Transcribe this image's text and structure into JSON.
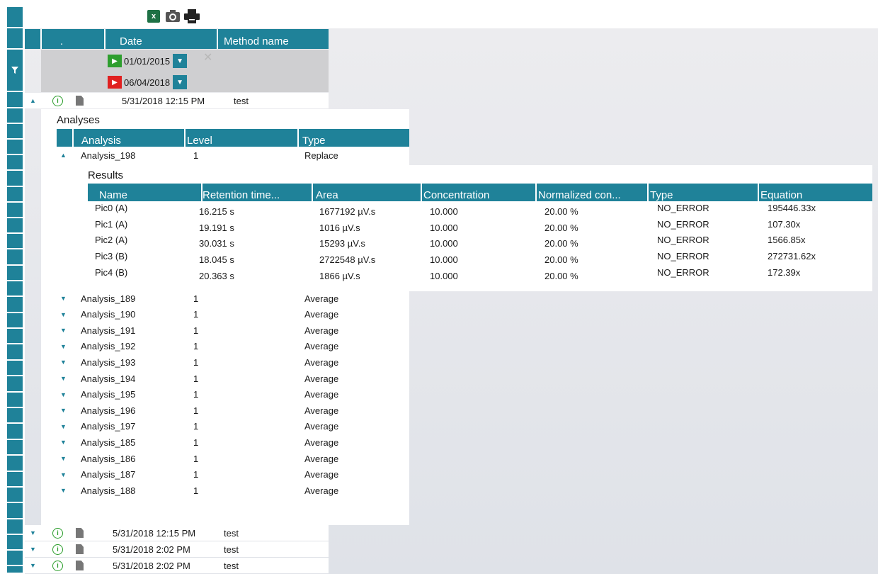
{
  "toolbar": {
    "excel_label": "x",
    "icons": [
      "excel-export-icon",
      "camera-icon",
      "printer-icon"
    ]
  },
  "grid": {
    "columns": [
      ".",
      "Date",
      "Method name"
    ],
    "filter": {
      "date_from": "01/01/2015",
      "date_to": "06/04/2018"
    },
    "rows": [
      {
        "date": "5/31/2018 12:15 PM",
        "method": "test",
        "expanded": true
      },
      {
        "date": "5/31/2018 12:15 PM",
        "method": "test",
        "expanded": false
      },
      {
        "date": "5/31/2018 2:02 PM",
        "method": "test",
        "expanded": false
      },
      {
        "date": "5/31/2018 2:02 PM",
        "method": "test",
        "expanded": false
      }
    ]
  },
  "analyses": {
    "title": "Analyses",
    "columns": [
      "Analysis",
      "Level",
      "Type"
    ],
    "expanded_row": {
      "name": "Analysis_198",
      "level": "1",
      "type": "Replace"
    },
    "rows": [
      {
        "name": "Analysis_189",
        "level": "1",
        "type": "Average"
      },
      {
        "name": "Analysis_190",
        "level": "1",
        "type": "Average"
      },
      {
        "name": "Analysis_191",
        "level": "1",
        "type": "Average"
      },
      {
        "name": "Analysis_192",
        "level": "1",
        "type": "Average"
      },
      {
        "name": "Analysis_193",
        "level": "1",
        "type": "Average"
      },
      {
        "name": "Analysis_194",
        "level": "1",
        "type": "Average"
      },
      {
        "name": "Analysis_195",
        "level": "1",
        "type": "Average"
      },
      {
        "name": "Analysis_196",
        "level": "1",
        "type": "Average"
      },
      {
        "name": "Analysis_197",
        "level": "1",
        "type": "Average"
      },
      {
        "name": "Analysis_185",
        "level": "1",
        "type": "Average"
      },
      {
        "name": "Analysis_186",
        "level": "1",
        "type": "Average"
      },
      {
        "name": "Analysis_187",
        "level": "1",
        "type": "Average"
      },
      {
        "name": "Analysis_188",
        "level": "1",
        "type": "Average"
      }
    ]
  },
  "results": {
    "title": "Results",
    "columns": [
      "Name",
      "Retention time...",
      "Area",
      "Concentration",
      "Normalized con...",
      "Type",
      "Equation"
    ],
    "rows": [
      {
        "name": "Pic0 (A)",
        "rt": "16.215 s",
        "area": "1677192 µV.s",
        "conc": "10.000",
        "norm": "20.00 %",
        "type": "NO_ERROR",
        "eq": "195446.33x"
      },
      {
        "name": "Pic1 (A)",
        "rt": "19.191 s",
        "area": "1016 µV.s",
        "conc": "10.000",
        "norm": "20.00 %",
        "type": "NO_ERROR",
        "eq": "107.30x"
      },
      {
        "name": "Pic2 (A)",
        "rt": "30.031 s",
        "area": "15293 µV.s",
        "conc": "10.000",
        "norm": "20.00 %",
        "type": "NO_ERROR",
        "eq": "1566.85x"
      },
      {
        "name": "Pic3 (B)",
        "rt": "18.045 s",
        "area": "2722548 µV.s",
        "conc": "10.000",
        "norm": "20.00 %",
        "type": "NO_ERROR",
        "eq": "272731.62x"
      },
      {
        "name": "Pic4 (B)",
        "rt": "20.363 s",
        "area": "1866 µV.s",
        "conc": "10.000",
        "norm": "20.00 %",
        "type": "NO_ERROR",
        "eq": "172.39x"
      }
    ]
  },
  "colors": {
    "accent": "#1f8299",
    "info": "#2a9d2a",
    "from_cal": "#2e9e2e",
    "to_cal": "#e02020"
  }
}
